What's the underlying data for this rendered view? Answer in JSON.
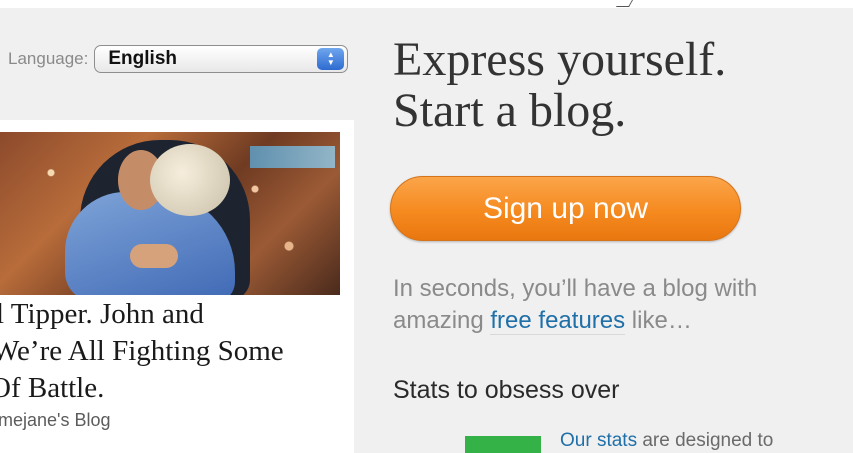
{
  "language": {
    "label": "Language:",
    "selected": "English"
  },
  "featured_post": {
    "title_lines": [
      "l Tipper. John and",
      "We’re All Fighting Some",
      "Of Battle."
    ],
    "author": "mejane's Blog"
  },
  "hero": {
    "headline_lines": [
      "Express yourself.",
      "Start a blog."
    ],
    "signup_label": "Sign up now",
    "intro_before": "In seconds, you’ll have a blog with amazing ",
    "intro_link": "free features",
    "intro_after": " like…"
  },
  "features": {
    "section_title": "Stats to obsess over",
    "stats_link": "Our stats",
    "stats_text": " are designed to"
  },
  "colors": {
    "signup_orange": "#f58a1f",
    "link_blue": "#1f6fa8",
    "stats_green": "#34b247"
  }
}
